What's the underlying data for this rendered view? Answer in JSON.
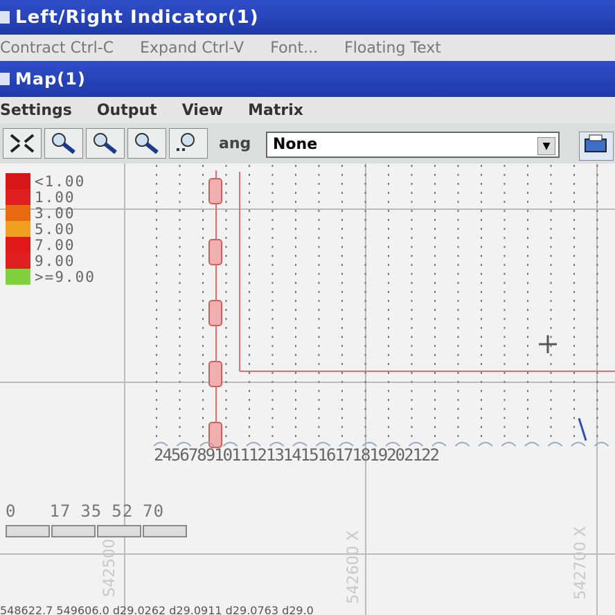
{
  "windows": {
    "indicator_title": "Left/Right Indicator(1)",
    "map_title": "Map(1)"
  },
  "indicator_menu": {
    "contract": "Contract Ctrl-C",
    "expand": "Expand Ctrl-V",
    "font": "Font...",
    "floating_text": "Floating Text"
  },
  "map_menu": {
    "settings": "Settings",
    "output": "Output",
    "view": "View",
    "matrix": "Matrix"
  },
  "toolbar": {
    "ang_label": "ang",
    "ang_value": "None",
    "tools": [
      "fit-extent-icon",
      "zoom-in-icon",
      "zoom-out-icon",
      "zoom-window-icon",
      "zoom-previous-icon"
    ]
  },
  "legend": [
    {
      "label": "<1.00",
      "color": "#d81818"
    },
    {
      "label": "1.00",
      "color": "#e02020"
    },
    {
      "label": "3.00",
      "color": "#e86a10"
    },
    {
      "label": "5.00",
      "color": "#f0a020"
    },
    {
      "label": "7.00",
      "color": "#e01818"
    },
    {
      "label": "9.00",
      "color": "#e02020"
    },
    {
      "label": ">=9.00",
      "color": "#80d040"
    }
  ],
  "tick_labels": [
    "2",
    "4",
    "5",
    "6",
    "7",
    "8",
    "9",
    "10",
    "11",
    "12",
    "13",
    "14",
    "15",
    "16",
    "17",
    "18",
    "19",
    "20",
    "21",
    "22"
  ],
  "scale": {
    "labels": [
      "0",
      "17",
      "35",
      "52",
      "70"
    ]
  },
  "axis_labels": {
    "x1": "542600 X",
    "x2": "542700 X",
    "y1": "S42500"
  },
  "status_bar": "548622.7 549606.0 d29.0262 d29.0911 d29.0763 d29.0"
}
